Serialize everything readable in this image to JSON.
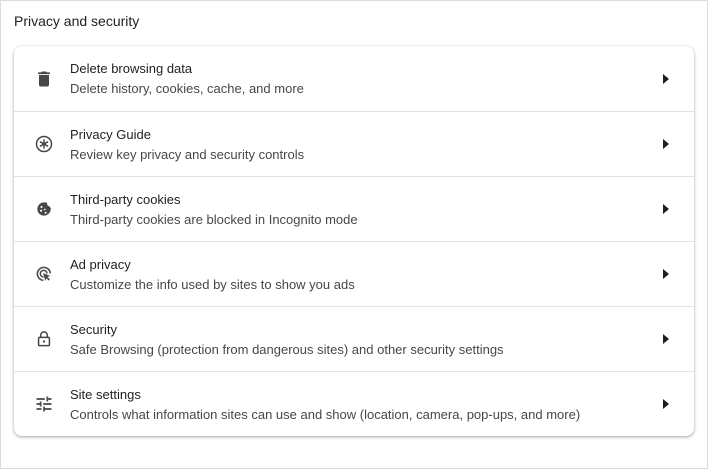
{
  "section": {
    "title": "Privacy and security"
  },
  "colors": {
    "icon": "#474747",
    "text_primary": "#1f1f1f",
    "text_secondary": "#474747",
    "divider": "#e3e3e3"
  },
  "items": [
    {
      "title": "Delete browsing data",
      "subtitle": "Delete history, cookies, cache, and more",
      "icon": "trash-icon"
    },
    {
      "title": "Privacy Guide",
      "subtitle": "Review key privacy and security controls",
      "icon": "privacy-guide-icon"
    },
    {
      "title": "Third-party cookies",
      "subtitle": "Third-party cookies are blocked in Incognito mode",
      "icon": "cookie-icon"
    },
    {
      "title": "Ad privacy",
      "subtitle": "Customize the info used by sites to show you ads",
      "icon": "ad-privacy-icon"
    },
    {
      "title": "Security",
      "subtitle": "Safe Browsing (protection from dangerous sites) and other security settings",
      "icon": "lock-icon"
    },
    {
      "title": "Site settings",
      "subtitle": "Controls what information sites can use and show (location, camera, pop-ups, and more)",
      "icon": "tune-icon"
    }
  ]
}
